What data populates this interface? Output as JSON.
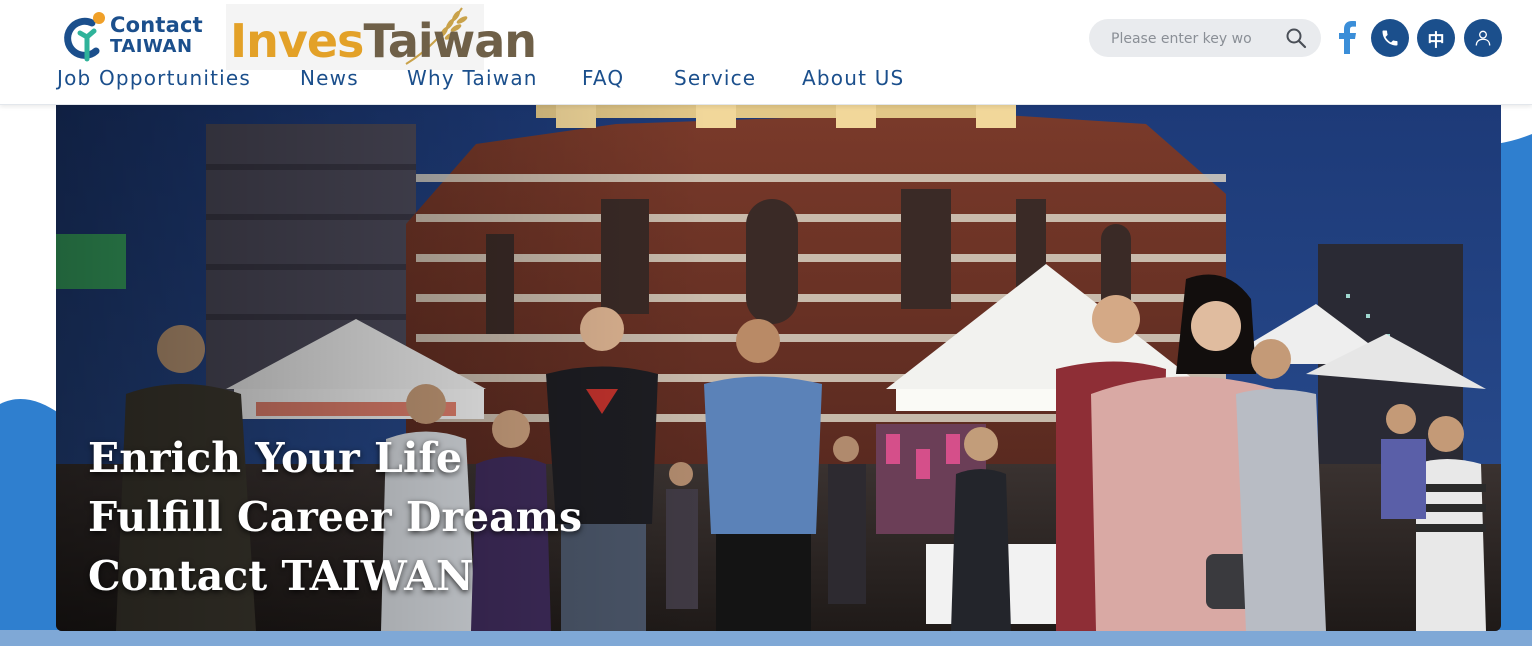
{
  "brand": {
    "contact_line1": "Contact",
    "contact_line2": "TAIWAN",
    "invest_part1": "Inves",
    "invest_part2": "Taiwan"
  },
  "nav": {
    "items": [
      {
        "label": "Job Opportunities"
      },
      {
        "label": "News"
      },
      {
        "label": "Why Taiwan"
      },
      {
        "label": "FAQ"
      },
      {
        "label": "Service"
      },
      {
        "label": "About US"
      }
    ]
  },
  "search": {
    "placeholder": "Please enter key wo",
    "icon": "search-icon"
  },
  "actions": {
    "facebook_icon": "facebook-icon",
    "phone_icon": "phone-icon",
    "language_label": "中",
    "user_icon": "user-icon"
  },
  "hero": {
    "lines": [
      "Enrich Your Life",
      "Fulfill Career Dreams",
      "Contact TAIWAN"
    ]
  },
  "colors": {
    "brand_blue": "#1b4f8c",
    "facebook_blue": "#3b8ed8",
    "logo_orange": "#e3a128",
    "logo_brown": "#6f6048",
    "search_bg": "#e9ebee"
  }
}
